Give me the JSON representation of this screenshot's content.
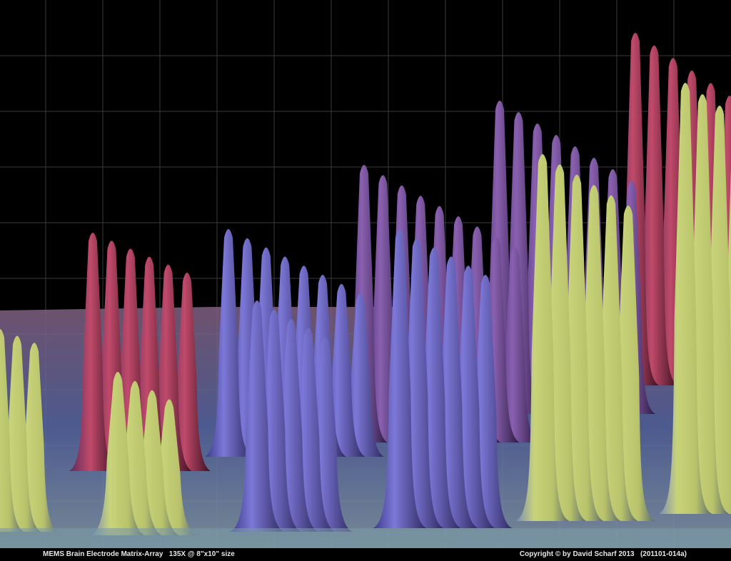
{
  "image": {
    "subject": "electrode-array-micrograph",
    "palette": {
      "background": "#000000",
      "grid": "#3a3a3a",
      "near": "#c8d070",
      "mid": "#7a70d0",
      "far": "#c04060",
      "substrate": "#6a78c0"
    }
  },
  "caption": {
    "left": "MEMS Brain Electrode Matrix-Array   135X @ 8\"x10\" size",
    "right": "Copyright © by David Scharf 2013   (201101-014a)"
  }
}
